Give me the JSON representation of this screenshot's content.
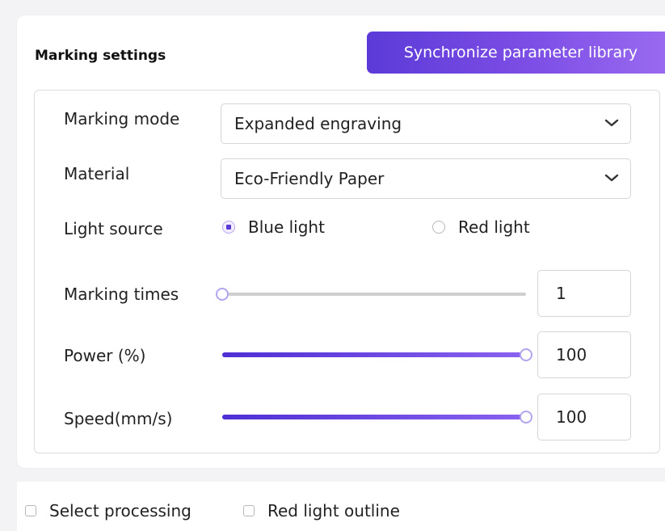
{
  "header": {
    "title": "Marking settings",
    "sync_button": "Synchronize parameter library"
  },
  "marking_mode": {
    "label": "Marking mode",
    "value": "Expanded engraving",
    "icon": "chevron-down-icon"
  },
  "material": {
    "label": "Material",
    "value": "Eco-Friendly Paper",
    "icon": "chevron-down-icon"
  },
  "light_source": {
    "label": "Light source",
    "options": [
      {
        "label": "Blue light",
        "selected": true
      },
      {
        "label": "Red light",
        "selected": false
      }
    ]
  },
  "marking_times": {
    "label": "Marking times",
    "value": "1",
    "fraction": 0.0
  },
  "power": {
    "label": "Power (%)",
    "value": "100",
    "fraction": 1.0
  },
  "speed": {
    "label": "Speed(mm/s)",
    "value": "100",
    "fraction": 1.0
  },
  "footer": {
    "select_processing": "Select processing",
    "red_light_outline": "Red light outline"
  },
  "colors": {
    "accent": "#5c3ad7",
    "accent_light": "#9b6cf0",
    "background": "#f3f3f5"
  }
}
